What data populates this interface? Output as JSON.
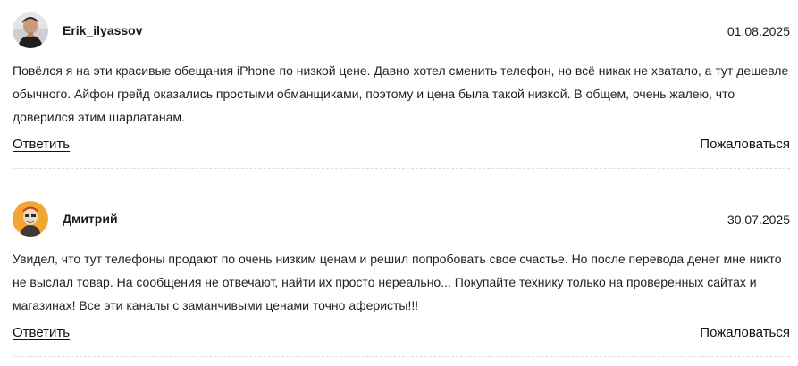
{
  "reviews": [
    {
      "author": "Erik_ilyassov",
      "date": "01.08.2025",
      "text": "Повёлся я на эти красивые обещания iPhone по низкой цене. Давно хотел сменить телефон, но всё никак не хватало, а тут дешевле обычного. Айфон грейд оказались простыми обманщиками, поэтому и цена была такой низкой. В общем, очень жалею, что доверился этим шарлатанам.",
      "reply_label": "Ответить",
      "complain_label": "Пожаловаться"
    },
    {
      "author": "Дмитрий",
      "date": "30.07.2025",
      "text": "Увидел, что тут телефоны продают по очень низким ценам и решил попробовать свое счастье. Но после перевода денег мне никто не выслал товар. На сообщения не отвечают, найти их просто нереально... Покупайте технику только на проверенных сайтах и магазинах! Все эти каналы с заманчивыми ценами точно аферисты!!!",
      "reply_label": "Ответить",
      "complain_label": "Пожаловаться"
    }
  ]
}
